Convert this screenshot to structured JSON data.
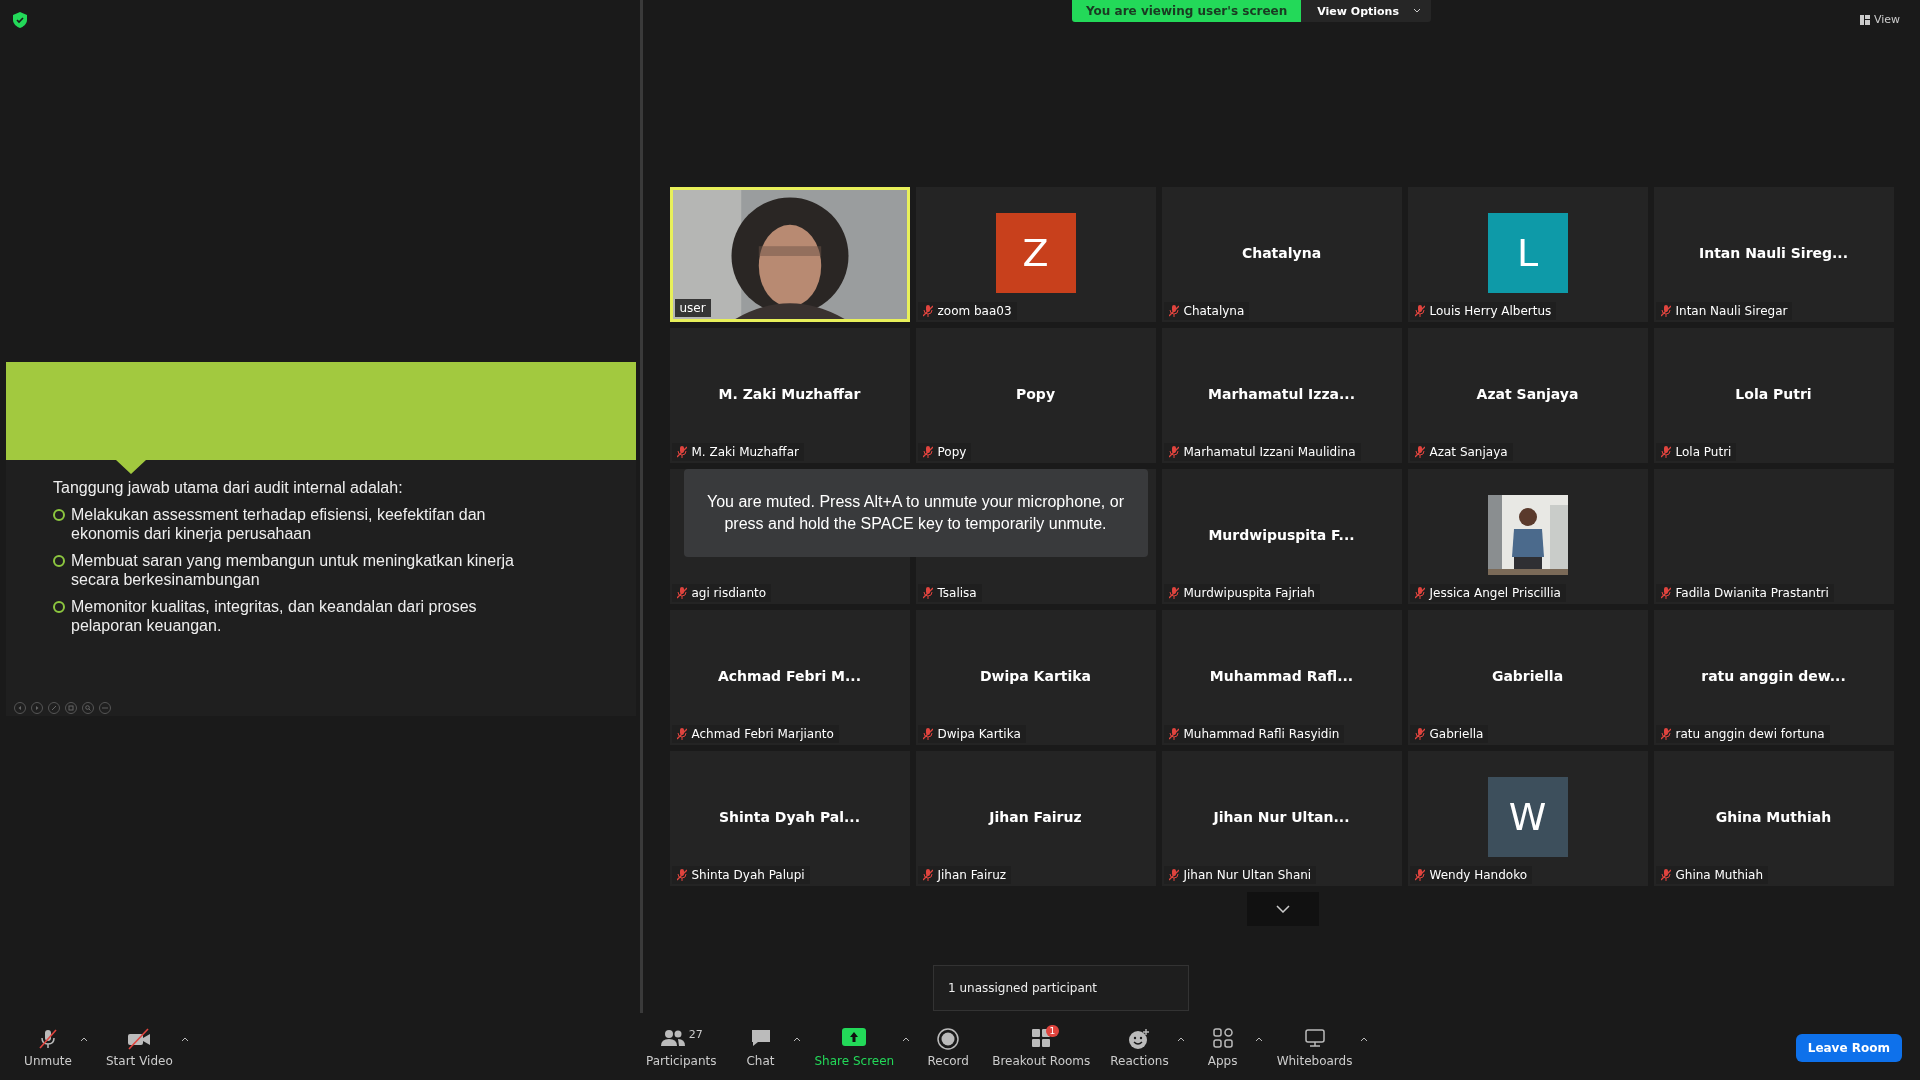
{
  "top_bar": {
    "banner": "You are viewing user's screen",
    "view_options": "View Options",
    "view": "View"
  },
  "slide": {
    "heading": "Tanggung jawab utama dari audit internal adalah:",
    "bullets": [
      "Melakukan assessment terhadap efisiensi, keefektifan dan ekonomis dari kinerja perusahaan",
      "Membuat saran yang membangun untuk meningkatkan kinerja secara berkesinambungan",
      "Memonitor kualitas, integritas, dan keandalan dari proses pelaporan keuangan."
    ]
  },
  "tiles": [
    {
      "kind": "video",
      "label": "user",
      "muted": false,
      "active": true
    },
    {
      "kind": "avatar",
      "letter": "Z",
      "color": "#c8401c",
      "label": "zoom baa03",
      "muted": true,
      "active": false
    },
    {
      "kind": "name",
      "name": "Chatalyna",
      "label": "Chatalyna",
      "muted": true,
      "active": false
    },
    {
      "kind": "avatar",
      "letter": "L",
      "color": "#0e9aa8",
      "label": "Louis Herry Albertus",
      "muted": true,
      "active": false
    },
    {
      "kind": "name",
      "name": "Intan Nauli Sireg...",
      "label": "Intan Nauli Siregar",
      "muted": true,
      "active": false
    },
    {
      "kind": "name",
      "name": "M. Zaki Muzhaffar",
      "label": "M. Zaki Muzhaffar",
      "muted": true,
      "active": false
    },
    {
      "kind": "name",
      "name": "Popy",
      "label": "Popy",
      "muted": true,
      "active": false
    },
    {
      "kind": "name",
      "name": "Marhamatul Izza...",
      "label": "Marhamatul Izzani Maulidina",
      "muted": true,
      "active": false
    },
    {
      "kind": "name",
      "name": "Azat Sanjaya",
      "label": "Azat Sanjaya",
      "muted": true,
      "active": false
    },
    {
      "kind": "name",
      "name": "Lola Putri",
      "label": "Lola Putri",
      "muted": true,
      "active": false
    },
    {
      "kind": "blank",
      "label": "agi risdianto",
      "muted": true,
      "active": false
    },
    {
      "kind": "blank",
      "label": "Tsalisa",
      "muted": true,
      "active": false
    },
    {
      "kind": "name",
      "name": "Murdwipuspita F...",
      "label": "Murdwipuspita Fajriah",
      "muted": true,
      "active": false
    },
    {
      "label": "Jessica Angel Priscillia",
      "muted": true,
      "active": false
    },
    {
      "kind": "blank",
      "label": "Fadila Dwianita Prastantri",
      "muted": true,
      "active": false
    },
    {
      "kind": "name",
      "name": "Achmad Febri M...",
      "label": "Achmad Febri Marjianto",
      "muted": true,
      "active": false
    },
    {
      "kind": "name",
      "name": "Dwipa Kartika",
      "label": "Dwipa Kartika",
      "muted": true,
      "active": false
    },
    {
      "kind": "name",
      "name": "Muhammad Rafl...",
      "label": "Muhammad Rafli Rasyidin",
      "muted": true,
      "active": false
    },
    {
      "kind": "name",
      "name": "Gabriella",
      "label": "Gabriella",
      "muted": true,
      "active": false
    },
    {
      "kind": "name",
      "name": "ratu anggin dew...",
      "label": "ratu anggin dewi fortuna",
      "muted": true,
      "active": false
    },
    {
      "kind": "name",
      "name": "Shinta Dyah Pal...",
      "label": "Shinta Dyah Palupi",
      "muted": true,
      "active": false
    },
    {
      "kind": "name",
      "name": "Jihan Fairuz",
      "label": "Jihan Fairuz",
      "muted": true,
      "active": false
    },
    {
      "kind": "name",
      "name": "Jihan Nur Ultan...",
      "label": "Jihan Nur Ultan Shani",
      "muted": true,
      "active": false
    },
    {
      "kind": "avatar",
      "letter": "W",
      "color": "#3d4f5c",
      "label": "Wendy Handoko",
      "muted": true,
      "active": false
    },
    {
      "kind": "name",
      "name": "Ghina Muthiah",
      "label": "Ghina Muthiah",
      "muted": true,
      "active": false
    }
  ],
  "muted_notice": "You are muted. Press Alt+A to unmute your microphone, or press and hold the SPACE key to temporarily unmute.",
  "tooltip": "1 unassigned participant",
  "toolbar_left": [
    {
      "kind": "mic",
      "label": "Unmute",
      "caret": true
    },
    {
      "kind": "video",
      "label": "Start Video",
      "caret": true
    }
  ],
  "toolbar_center": [
    {
      "kind": "participants",
      "label": "Participants",
      "count": "27",
      "caret": false
    },
    {
      "kind": "chat",
      "label": "Chat",
      "caret": true
    },
    {
      "kind": "share",
      "label": "Share Screen",
      "caret": true
    },
    {
      "kind": "record",
      "label": "Record",
      "caret": false
    },
    {
      "kind": "breakout",
      "label": "Breakout Rooms",
      "badge": "1",
      "caret": false
    },
    {
      "kind": "reactions",
      "label": "Reactions",
      "caret": true
    },
    {
      "kind": "apps",
      "label": "Apps",
      "caret": true
    },
    {
      "kind": "whiteboards",
      "label": "Whiteboards",
      "caret": true
    }
  ],
  "leave_button": "Leave Room"
}
